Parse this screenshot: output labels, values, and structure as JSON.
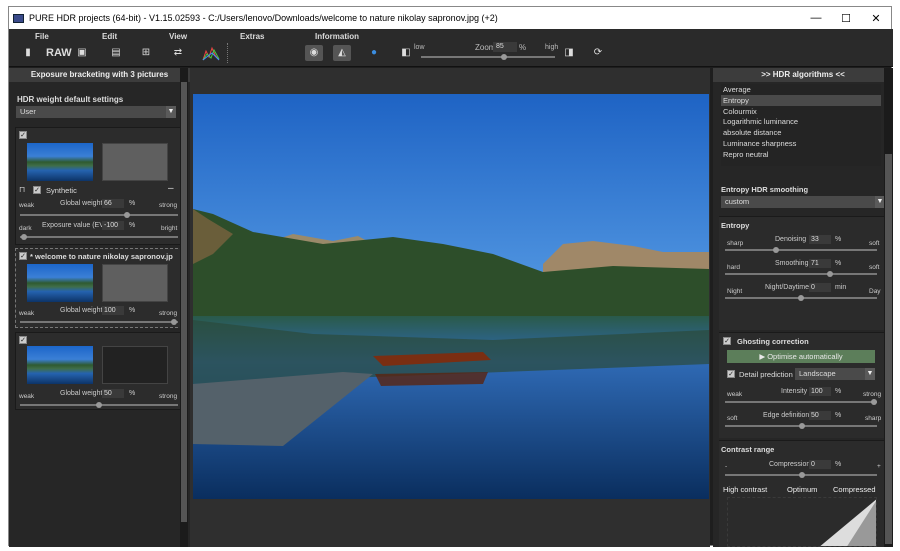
{
  "window": {
    "title": "PURE HDR projects (64-bit) - V1.15.02593 - C:/Users/lenovo/Downloads/welcome to nature nikolay sapronov.jpg (+2)",
    "minimize": "—",
    "maximize": "☐",
    "close": "✕"
  },
  "menu": {
    "file": "File",
    "edit": "Edit",
    "view": "View",
    "extras": "Extras",
    "information": "Information"
  },
  "toolbar": {
    "raw": "RAW",
    "zoom_label": "Zoom",
    "zoom_value": "85",
    "zoom_unit": "%",
    "zoom_low": "low",
    "zoom_high": "high",
    "zoom_level": 0.62
  },
  "left": {
    "header": "Exposure bracketing with 3 pictures",
    "weight_title": "HDR weight default settings",
    "weight_preset": "User",
    "synthetic_label": "Synthetic",
    "collapse": "–",
    "card1": {
      "global_weight_label": "Global weight",
      "global_weight_value": "66",
      "unit": "%",
      "weak": "weak",
      "strong": "strong",
      "exposure_label": "Exposure value (EV)",
      "exposure_value": "-100",
      "dark": "dark",
      "bright": "bright"
    },
    "card2": {
      "filename": "* welcome to nature nikolay sapronov.jp",
      "global_weight_label": "Global weight",
      "global_weight_value": "100",
      "unit": "%",
      "weak": "weak",
      "strong": "strong"
    },
    "card3": {
      "global_weight_label": "Global weight",
      "global_weight_value": "50",
      "unit": "%",
      "weak": "weak",
      "strong": "strong"
    }
  },
  "right": {
    "header": ">> HDR algorithms <<",
    "algorithms": [
      "Average",
      "Entropy",
      "Colourmix",
      "Logarithmic luminance",
      "absolute distance",
      "Luminance sharpness",
      "Repro neutral"
    ],
    "selected_algorithm": "Entropy",
    "smoothing_title": "Entropy HDR smoothing",
    "smoothing_preset": "custom",
    "entropy_title": "Entropy",
    "denoising": {
      "label": "Denoising",
      "value": "33",
      "unit": "%",
      "left": "sharp",
      "right": "soft"
    },
    "smoothing": {
      "label": "Smoothing",
      "value": "71",
      "unit": "%",
      "left": "hard",
      "right": "soft"
    },
    "nightday": {
      "label": "Night/Daytime",
      "value": "0",
      "unit": "min",
      "left": "Night",
      "right": "Day"
    },
    "ghosting_title": "Ghosting correction",
    "optimise_label": "Optimise automatically",
    "detail_label": "Detail prediction",
    "detail_preset": "Landscape",
    "intensity": {
      "label": "Intensity",
      "value": "100",
      "unit": "%",
      "left": "weak",
      "right": "strong"
    },
    "edge": {
      "label": "Edge definition",
      "value": "50",
      "unit": "%",
      "left": "soft",
      "right": "sharp"
    },
    "contrast_title": "Contrast range",
    "compression": {
      "label": "Compression",
      "value": "0",
      "unit": "%",
      "left": "-",
      "right": "+"
    },
    "tabs": [
      "High contrast",
      "Optimum",
      "Compressed"
    ]
  },
  "colors": {
    "accent_green": "#5c7e5a",
    "panel_bg": "#262626"
  }
}
